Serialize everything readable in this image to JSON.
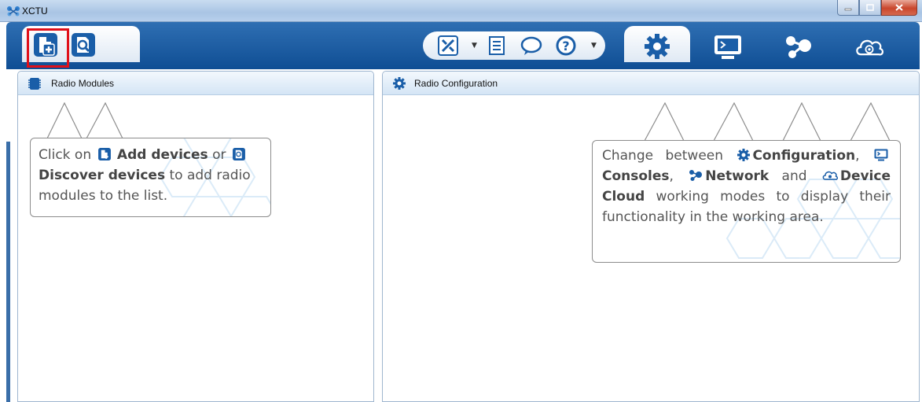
{
  "window": {
    "title": "XCTU"
  },
  "toolbar": {
    "left_buttons": [
      "add-devices",
      "discover-devices"
    ],
    "tools": [
      "xctu-tools",
      "frames-generator",
      "feedback",
      "help"
    ],
    "modes": [
      "configuration",
      "consoles",
      "network",
      "device-cloud"
    ]
  },
  "panels": {
    "left": {
      "title": "Radio Modules"
    },
    "right": {
      "title": "Radio Configuration"
    }
  },
  "hints": {
    "left": {
      "p1": "Click on",
      "add": "Add devices",
      "p2": "or",
      "discover": "Discover devices",
      "p3": "to add radio modules to the list."
    },
    "right": {
      "p1": "Change between",
      "configuration": "Configuration",
      "consoles": "Consoles",
      "network": "Network",
      "p2": "and",
      "cloud": "Device Cloud",
      "p3": "working modes to display their functionality in the working area."
    }
  },
  "colors": {
    "accent": "#1a5ea8",
    "highlight": "#e0101a"
  }
}
